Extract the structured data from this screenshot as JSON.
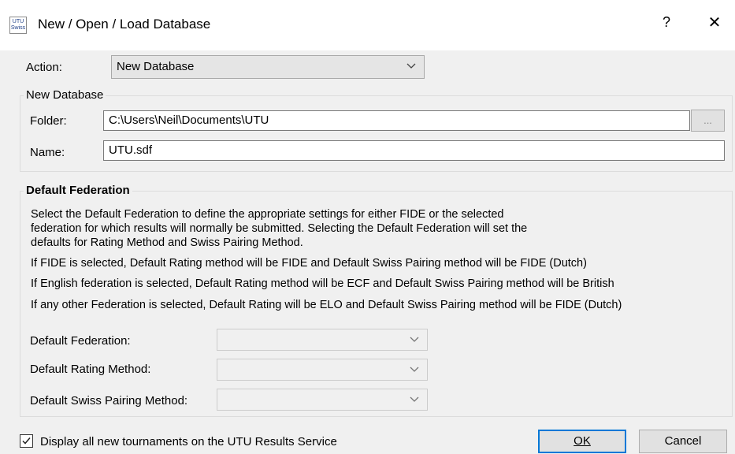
{
  "window": {
    "icon_text": "UTU Swiss",
    "title": "New / Open / Load Database",
    "help_glyph": "?",
    "close_glyph": "✕"
  },
  "action": {
    "label": "Action:",
    "selected": "New Database"
  },
  "new_database": {
    "group_title": "New Database",
    "folder_label": "Folder:",
    "folder_value": "C:\\Users\\Neil\\Documents\\UTU",
    "browse_label": "...",
    "name_label": "Name:",
    "name_value": "UTU.sdf"
  },
  "default_federation": {
    "group_title": "Default Federation",
    "description_lines": [
      "Select the Default Federation to define the appropriate settings for either FIDE or the selected",
      "federation for which results will normally be submitted. Selecting the Default Federation will set the",
      "defaults for Rating Method and Swiss Pairing Method."
    ],
    "note_fide": "If FIDE is selected, Default Rating method will be FIDE and Default Swiss Pairing method will be FIDE (Dutch)",
    "note_english": "If English federation is selected, Default Rating method will be ECF and Default Swiss Pairing method will be British",
    "note_other": "If any other Federation is selected, Default Rating will be ELO and Default Swiss Pairing method will be FIDE (Dutch)",
    "federation_label": "Default Federation:",
    "federation_value": "",
    "rating_label": "Default Rating Method:",
    "rating_value": "",
    "pairing_label": "Default Swiss Pairing Method:",
    "pairing_value": ""
  },
  "footer": {
    "checkbox_checked": true,
    "checkbox_label": "Display all new tournaments on the UTU Results Service",
    "ok_label": "OK",
    "cancel_label": "Cancel"
  },
  "icons": {
    "chevron": "chevron-down-icon",
    "check": "checkmark-icon"
  }
}
